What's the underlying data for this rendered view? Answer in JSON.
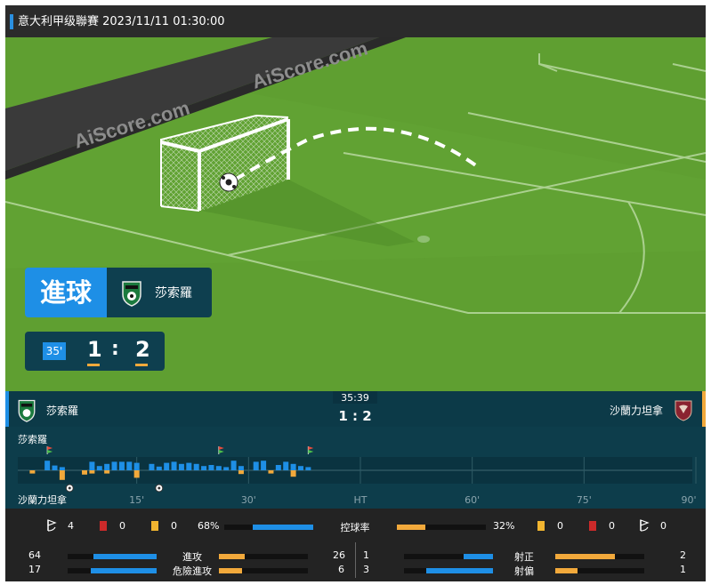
{
  "header": {
    "title": "意大利甲级聯賽 2023/11/11 01:30:00"
  },
  "pitch": {
    "watermark_1": "AiScore.com",
    "watermark_2": "AiScore.com"
  },
  "event": {
    "type_label": "進球",
    "team_name": "莎索羅",
    "minute": "35'",
    "home_score": "1",
    "separator": ":",
    "away_score": "2"
  },
  "scorebar": {
    "home_team": "莎索羅",
    "away_team": "沙蘭力坦拿",
    "clock": "35:39",
    "score": "1 : 2"
  },
  "timeline": {
    "home_label": "莎索羅",
    "away_label": "沙蘭力坦拿",
    "ticks": [
      "15'",
      "30'",
      "HT",
      "60'",
      "75'",
      "90'"
    ],
    "max_minute": 90,
    "home_bars": [
      {
        "minute": 3,
        "level": 0.9
      },
      {
        "minute": 4,
        "level": 0.45
      },
      {
        "minute": 5,
        "level": 0.3
      },
      {
        "minute": 9,
        "level": 0.8
      },
      {
        "minute": 10,
        "level": 0.4
      },
      {
        "minute": 11,
        "level": 0.6
      },
      {
        "minute": 12,
        "level": 0.8
      },
      {
        "minute": 13,
        "level": 0.8
      },
      {
        "minute": 14,
        "level": 0.8
      },
      {
        "minute": 15,
        "level": 0.7
      },
      {
        "minute": 17,
        "level": 0.6
      },
      {
        "minute": 18,
        "level": 0.35
      },
      {
        "minute": 19,
        "level": 0.7
      },
      {
        "minute": 20,
        "level": 0.8
      },
      {
        "minute": 21,
        "level": 0.6
      },
      {
        "minute": 22,
        "level": 0.7
      },
      {
        "minute": 23,
        "level": 0.6
      },
      {
        "minute": 24,
        "level": 0.4
      },
      {
        "minute": 25,
        "level": 0.5
      },
      {
        "minute": 26,
        "level": 0.4
      },
      {
        "minute": 27,
        "level": 0.3
      },
      {
        "minute": 28,
        "level": 0.9
      },
      {
        "minute": 29,
        "level": 0.4
      },
      {
        "minute": 31,
        "level": 0.8
      },
      {
        "minute": 32,
        "level": 0.9
      },
      {
        "minute": 34,
        "level": 0.5
      },
      {
        "minute": 35,
        "level": 0.8
      },
      {
        "minute": 36,
        "level": 0.6
      },
      {
        "minute": 37,
        "level": 0.4
      },
      {
        "minute": 38,
        "level": 0.3
      }
    ],
    "away_bars": [
      {
        "minute": 1,
        "level": 0.3
      },
      {
        "minute": 5,
        "level": 0.9
      },
      {
        "minute": 8,
        "level": 0.4
      },
      {
        "minute": 9,
        "level": 0.3
      },
      {
        "minute": 11,
        "level": 0.3
      },
      {
        "minute": 15,
        "level": 0.7
      },
      {
        "minute": 29,
        "level": 0.35
      },
      {
        "minute": 33,
        "level": 0.3
      },
      {
        "minute": 36,
        "level": 0.6
      }
    ],
    "home_events": [
      {
        "minute": 3,
        "icon": "corner-flag-icon"
      },
      {
        "minute": 26,
        "icon": "corner-flag-icon"
      },
      {
        "minute": 38,
        "icon": "corner-flag-icon"
      }
    ],
    "away_events": [
      {
        "minute": 6,
        "icon": "ball-icon"
      },
      {
        "minute": 18,
        "icon": "ball-icon"
      }
    ],
    "colors": {
      "home": "#1e8fe6",
      "away": "#f2a93b"
    }
  },
  "stats": {
    "possession": {
      "label": "控球率",
      "home": "68%",
      "away": "32%",
      "home_value": 68,
      "away_value": 32
    },
    "home_corners": "4",
    "home_red": "0",
    "home_yellow": "0",
    "away_yellow": "0",
    "away_red": "0",
    "away_corners": "0",
    "attacks": {
      "label": "進攻",
      "home": "64",
      "away": "26",
      "home_value": 64,
      "away_value": 26
    },
    "dangerous": {
      "label": "危險進攻",
      "home": "17",
      "away": "6",
      "home_value": 17,
      "away_value": 6
    },
    "on_target": {
      "label": "射正",
      "home": "1",
      "away": "2",
      "home_value": 1,
      "away_value": 2
    },
    "off_target": {
      "label": "射偏",
      "home": "3",
      "away": "1",
      "home_value": 3,
      "away_value": 1
    }
  }
}
